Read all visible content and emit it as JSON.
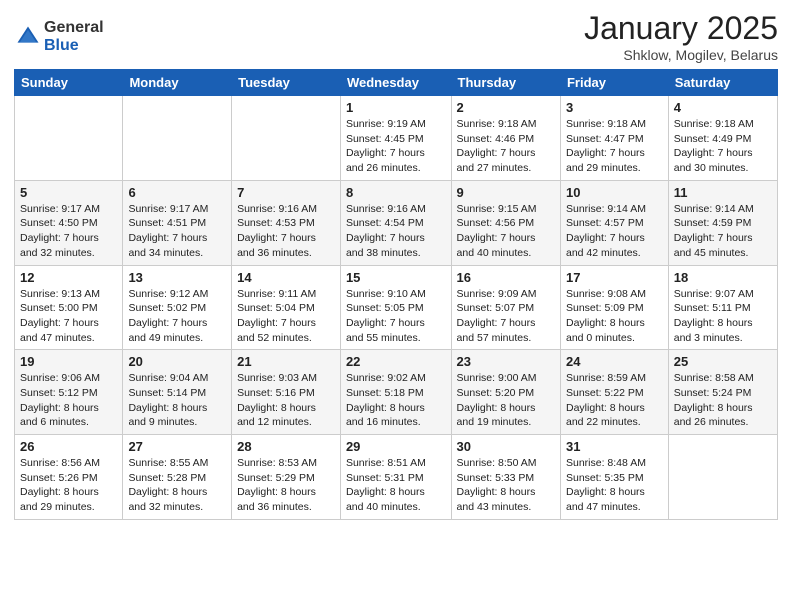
{
  "header": {
    "logo_line1": "General",
    "logo_line2": "Blue",
    "month_year": "January 2025",
    "location": "Shklow, Mogilev, Belarus"
  },
  "weekdays": [
    "Sunday",
    "Monday",
    "Tuesday",
    "Wednesday",
    "Thursday",
    "Friday",
    "Saturday"
  ],
  "weeks": [
    [
      {
        "day": "",
        "info": ""
      },
      {
        "day": "",
        "info": ""
      },
      {
        "day": "",
        "info": ""
      },
      {
        "day": "1",
        "info": "Sunrise: 9:19 AM\nSunset: 4:45 PM\nDaylight: 7 hours\nand 26 minutes."
      },
      {
        "day": "2",
        "info": "Sunrise: 9:18 AM\nSunset: 4:46 PM\nDaylight: 7 hours\nand 27 minutes."
      },
      {
        "day": "3",
        "info": "Sunrise: 9:18 AM\nSunset: 4:47 PM\nDaylight: 7 hours\nand 29 minutes."
      },
      {
        "day": "4",
        "info": "Sunrise: 9:18 AM\nSunset: 4:49 PM\nDaylight: 7 hours\nand 30 minutes."
      }
    ],
    [
      {
        "day": "5",
        "info": "Sunrise: 9:17 AM\nSunset: 4:50 PM\nDaylight: 7 hours\nand 32 minutes."
      },
      {
        "day": "6",
        "info": "Sunrise: 9:17 AM\nSunset: 4:51 PM\nDaylight: 7 hours\nand 34 minutes."
      },
      {
        "day": "7",
        "info": "Sunrise: 9:16 AM\nSunset: 4:53 PM\nDaylight: 7 hours\nand 36 minutes."
      },
      {
        "day": "8",
        "info": "Sunrise: 9:16 AM\nSunset: 4:54 PM\nDaylight: 7 hours\nand 38 minutes."
      },
      {
        "day": "9",
        "info": "Sunrise: 9:15 AM\nSunset: 4:56 PM\nDaylight: 7 hours\nand 40 minutes."
      },
      {
        "day": "10",
        "info": "Sunrise: 9:14 AM\nSunset: 4:57 PM\nDaylight: 7 hours\nand 42 minutes."
      },
      {
        "day": "11",
        "info": "Sunrise: 9:14 AM\nSunset: 4:59 PM\nDaylight: 7 hours\nand 45 minutes."
      }
    ],
    [
      {
        "day": "12",
        "info": "Sunrise: 9:13 AM\nSunset: 5:00 PM\nDaylight: 7 hours\nand 47 minutes."
      },
      {
        "day": "13",
        "info": "Sunrise: 9:12 AM\nSunset: 5:02 PM\nDaylight: 7 hours\nand 49 minutes."
      },
      {
        "day": "14",
        "info": "Sunrise: 9:11 AM\nSunset: 5:04 PM\nDaylight: 7 hours\nand 52 minutes."
      },
      {
        "day": "15",
        "info": "Sunrise: 9:10 AM\nSunset: 5:05 PM\nDaylight: 7 hours\nand 55 minutes."
      },
      {
        "day": "16",
        "info": "Sunrise: 9:09 AM\nSunset: 5:07 PM\nDaylight: 7 hours\nand 57 minutes."
      },
      {
        "day": "17",
        "info": "Sunrise: 9:08 AM\nSunset: 5:09 PM\nDaylight: 8 hours\nand 0 minutes."
      },
      {
        "day": "18",
        "info": "Sunrise: 9:07 AM\nSunset: 5:11 PM\nDaylight: 8 hours\nand 3 minutes."
      }
    ],
    [
      {
        "day": "19",
        "info": "Sunrise: 9:06 AM\nSunset: 5:12 PM\nDaylight: 8 hours\nand 6 minutes."
      },
      {
        "day": "20",
        "info": "Sunrise: 9:04 AM\nSunset: 5:14 PM\nDaylight: 8 hours\nand 9 minutes."
      },
      {
        "day": "21",
        "info": "Sunrise: 9:03 AM\nSunset: 5:16 PM\nDaylight: 8 hours\nand 12 minutes."
      },
      {
        "day": "22",
        "info": "Sunrise: 9:02 AM\nSunset: 5:18 PM\nDaylight: 8 hours\nand 16 minutes."
      },
      {
        "day": "23",
        "info": "Sunrise: 9:00 AM\nSunset: 5:20 PM\nDaylight: 8 hours\nand 19 minutes."
      },
      {
        "day": "24",
        "info": "Sunrise: 8:59 AM\nSunset: 5:22 PM\nDaylight: 8 hours\nand 22 minutes."
      },
      {
        "day": "25",
        "info": "Sunrise: 8:58 AM\nSunset: 5:24 PM\nDaylight: 8 hours\nand 26 minutes."
      }
    ],
    [
      {
        "day": "26",
        "info": "Sunrise: 8:56 AM\nSunset: 5:26 PM\nDaylight: 8 hours\nand 29 minutes."
      },
      {
        "day": "27",
        "info": "Sunrise: 8:55 AM\nSunset: 5:28 PM\nDaylight: 8 hours\nand 32 minutes."
      },
      {
        "day": "28",
        "info": "Sunrise: 8:53 AM\nSunset: 5:29 PM\nDaylight: 8 hours\nand 36 minutes."
      },
      {
        "day": "29",
        "info": "Sunrise: 8:51 AM\nSunset: 5:31 PM\nDaylight: 8 hours\nand 40 minutes."
      },
      {
        "day": "30",
        "info": "Sunrise: 8:50 AM\nSunset: 5:33 PM\nDaylight: 8 hours\nand 43 minutes."
      },
      {
        "day": "31",
        "info": "Sunrise: 8:48 AM\nSunset: 5:35 PM\nDaylight: 8 hours\nand 47 minutes."
      },
      {
        "day": "",
        "info": ""
      }
    ]
  ]
}
